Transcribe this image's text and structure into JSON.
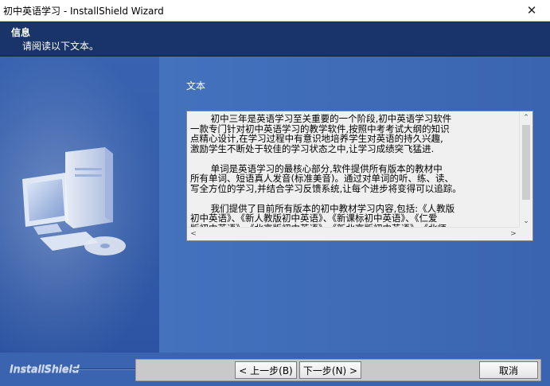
{
  "window": {
    "title": "初中英语学习 - InstallShield Wizard",
    "close_glyph": "✕"
  },
  "header": {
    "title": "信息",
    "subtitle": "请阅读以下文本。"
  },
  "main": {
    "section_label": "文本",
    "textbox_content": "       初中三年是英语学习至关重要的一个阶段,初中英语学习软件\n一款专门针对初中英语学习的教学软件,按照中考考试大纲的知识\n点精心设计,在学习过程中有意识地培养学生对英语的持久兴趣,\n激励学生不断处于较佳的学习状态之中,让学习成绩突飞猛进.\n\n       单词是英语学习的最核心部分,软件提供所有版本的教材中\n所有单词、短语真人发音(标准美音)。通过对单词的听、练、读、\n写全方位的学习,并结合学习反馈系统,让每个进步将变得可以追踪。\n\n       我们提供了目前所有版本的初中教材学习内容,包括:《人教版\n初中英语》、《新人教版初中英语》、《新课标初中英语》、《仁爱\n版初中英语》、《北京版初中英语》、《新北京版初中英语》、《北师"
  },
  "scrollbar": {
    "up_glyph": "⌃",
    "down_glyph": "⌄",
    "left_glyph": "<",
    "right_glyph": ">"
  },
  "footer": {
    "brand": "InstallShield",
    "back_label": "< 上一步(B)",
    "next_label": "下一步(N) >",
    "cancel_label": "取消"
  }
}
